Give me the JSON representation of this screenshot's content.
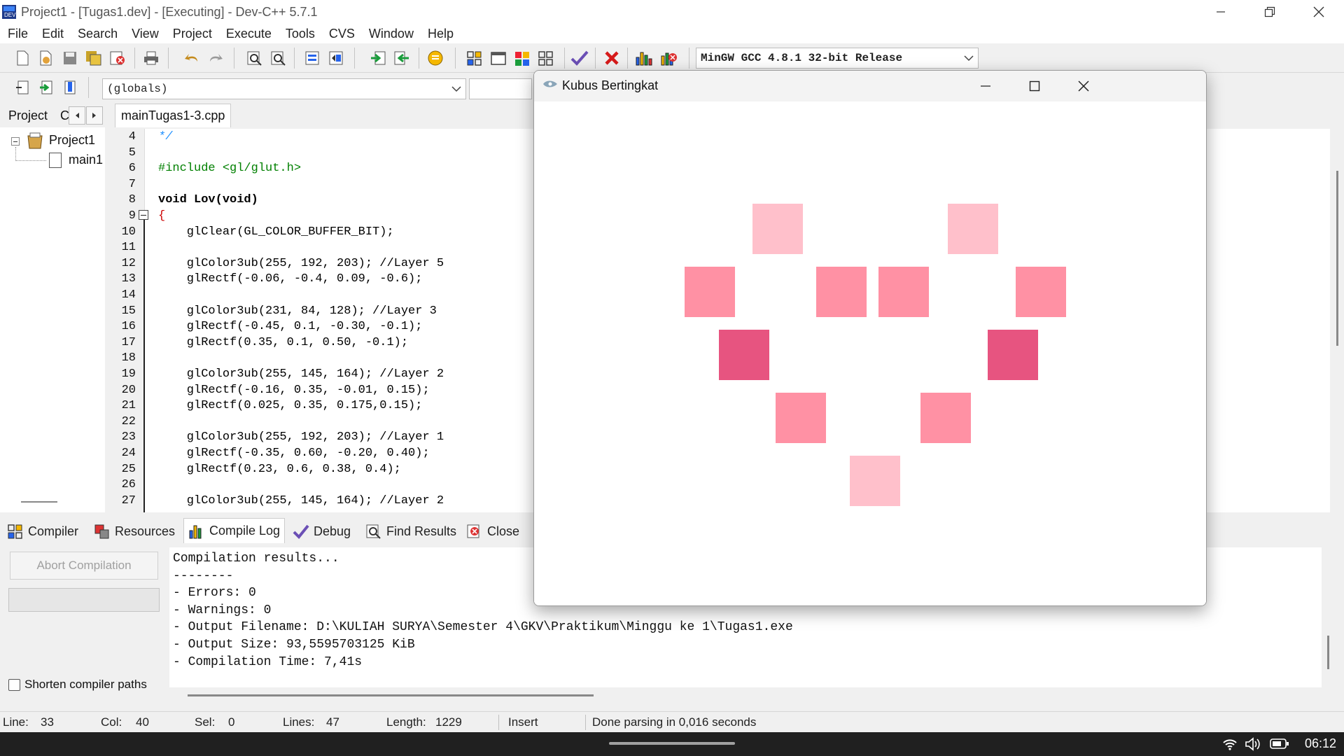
{
  "window": {
    "title": "Project1 - [Tugas1.dev] - [Executing] - Dev-C++ 5.7.1"
  },
  "menu": [
    "File",
    "Edit",
    "Search",
    "View",
    "Project",
    "Execute",
    "Tools",
    "CVS",
    "Window",
    "Help"
  ],
  "toolbar": {
    "compiler_select": "MinGW GCC 4.8.1 32-bit Release",
    "scope_select": "(globals)"
  },
  "left_panel": {
    "tabs": [
      "Project",
      "C"
    ],
    "tree": {
      "project": "Project1",
      "file": "main1"
    }
  },
  "editor": {
    "tab": "mainTugas1-3.cpp",
    "lines": [
      {
        "n": "4",
        "t": "*/"
      },
      {
        "n": "5",
        "t": ""
      },
      {
        "n": "6",
        "t": "#include <gl/glut.h>"
      },
      {
        "n": "7",
        "t": ""
      },
      {
        "n": "8",
        "t": "void Lov(void)"
      },
      {
        "n": "9",
        "t": "{"
      },
      {
        "n": "10",
        "t": "    glClear(GL_COLOR_BUFFER_BIT);"
      },
      {
        "n": "11",
        "t": ""
      },
      {
        "n": "12",
        "t": "    glColor3ub(255, 192, 203); //Layer 5"
      },
      {
        "n": "13",
        "t": "    glRectf(-0.06, -0.4, 0.09, -0.6);"
      },
      {
        "n": "14",
        "t": ""
      },
      {
        "n": "15",
        "t": "    glColor3ub(231, 84, 128); //Layer 3"
      },
      {
        "n": "16",
        "t": "    glRectf(-0.45, 0.1, -0.30, -0.1);"
      },
      {
        "n": "17",
        "t": "    glRectf(0.35, 0.1, 0.50, -0.1);"
      },
      {
        "n": "18",
        "t": ""
      },
      {
        "n": "19",
        "t": "    glColor3ub(255, 145, 164); //Layer 2"
      },
      {
        "n": "20",
        "t": "    glRectf(-0.16, 0.35, -0.01, 0.15);"
      },
      {
        "n": "21",
        "t": "    glRectf(0.025, 0.35, 0.175,0.15);"
      },
      {
        "n": "22",
        "t": ""
      },
      {
        "n": "23",
        "t": "    glColor3ub(255, 192, 203); //Layer 1"
      },
      {
        "n": "24",
        "t": "    glRectf(-0.35, 0.60, -0.20, 0.40);"
      },
      {
        "n": "25",
        "t": "    glRectf(0.23, 0.6, 0.38, 0.4);"
      },
      {
        "n": "26",
        "t": ""
      },
      {
        "n": "27",
        "t": "    glColor3ub(255, 145, 164); //Layer 2"
      }
    ]
  },
  "bottom_tabs": [
    "Compiler",
    "Resources",
    "Compile Log",
    "Debug",
    "Find Results",
    "Close"
  ],
  "compile": {
    "abort_button": "Abort Compilation",
    "shorten_paths": "Shorten compiler paths",
    "log": [
      "Compilation results...",
      "--------",
      "- Errors: 0",
      "- Warnings: 0",
      "- Output Filename: D:\\KULIAH SURYA\\Semester 4\\GKV\\Praktikum\\Minggu ke 1\\Tugas1.exe",
      "- Output Size: 93,5595703125 KiB",
      "- Compilation Time: 7,41s"
    ]
  },
  "status": {
    "line_label": "Line:",
    "line": "33",
    "col_label": "Col:",
    "col": "40",
    "sel_label": "Sel:",
    "sel": "0",
    "lines_label": "Lines:",
    "lines": "47",
    "length_label": "Length:",
    "length": "1229",
    "mode": "Insert",
    "message": "Done parsing in 0,016 seconds"
  },
  "taskbar": {
    "time": "06:12"
  },
  "gl_window": {
    "title": "Kubus Bertingkat",
    "colors": {
      "light": "#FFC0CB",
      "mid": "#FF91A4",
      "dark": "#E75480"
    }
  }
}
